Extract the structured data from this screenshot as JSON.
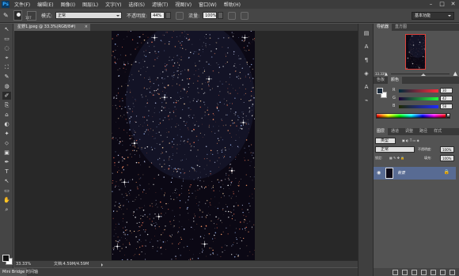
{
  "app": {
    "logo": "Ps"
  },
  "menu": [
    "文件(F)",
    "编辑(E)",
    "图像(I)",
    "图层(L)",
    "文字(Y)",
    "选择(S)",
    "滤镜(T)",
    "视图(V)",
    "窗口(W)",
    "帮助(H)"
  ],
  "window_controls": {
    "minimize": "–",
    "maximize": "□",
    "close": "✕"
  },
  "options": {
    "brush_size": "107",
    "mode_label": "模式:",
    "mode_value": "正常",
    "opacity_label": "不透明度:",
    "opacity_value": "44%",
    "flow_label": "流量:",
    "flow_value": "100%",
    "workspace": "基本功能"
  },
  "tools": [
    "↖",
    "▭",
    "◌",
    "⌖",
    "⛶",
    "✎",
    "◍",
    "✐",
    "⎘",
    "⌂",
    "◐",
    "✦",
    "⬦",
    "▣",
    "✒",
    "T",
    "↖",
    "▭",
    "✋",
    "⌕"
  ],
  "document": {
    "tab_title": "星野1.jpeg @ 33.3%(RGB/8#)",
    "tab_close": "×",
    "zoom": "33.33%",
    "doc_size": "文档:4.59M/4.59M"
  },
  "bottom_tabs": [
    "Mini Bridge",
    "时间轴"
  ],
  "right_strip": [
    "▤",
    "A",
    "¶",
    "◈",
    "A",
    "⌁"
  ],
  "navigator": {
    "tabs": [
      "导航器",
      "直方图"
    ],
    "zoom": "33.33%"
  },
  "color_panel": {
    "tabs": [
      "色板",
      "颜色"
    ],
    "channels": [
      {
        "label": "R",
        "value": "30"
      },
      {
        "label": "G",
        "value": "42"
      },
      {
        "label": "B",
        "value": "58"
      }
    ]
  },
  "layers": {
    "tabs": [
      "图层",
      "通道",
      "调整",
      "路径",
      "样式"
    ],
    "kind": "类型",
    "blend": "正常",
    "opacity_label": "不透明度:",
    "opacity_value": "100%",
    "lock_label": "锁定:",
    "fill_label": "填充:",
    "fill_value": "100%",
    "layer_name": "背景"
  },
  "colors": {
    "menubar": "#3c3c3c",
    "panel": "#535353",
    "layer_selected": "#586b93",
    "nav_frame": "#e0403a"
  }
}
